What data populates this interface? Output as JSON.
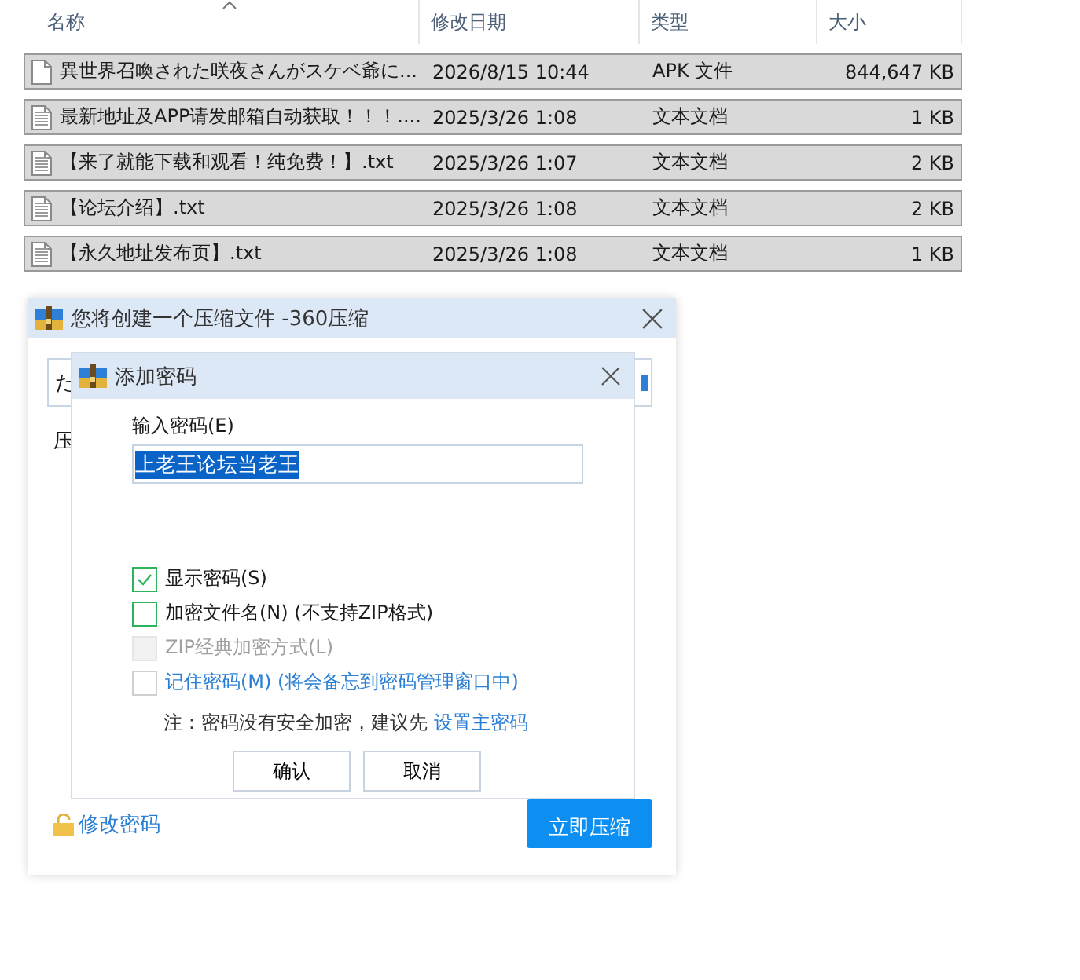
{
  "file_list": {
    "columns": [
      "名称",
      "修改日期",
      "类型",
      "大小"
    ],
    "rows": [
      {
        "kind": "blank",
        "name": "異世界召喚された咲夜さんがスケベ爺に...",
        "date": "2026/8/15 10:44",
        "type": "APK 文件",
        "size": "844,647 KB",
        "selected": true
      },
      {
        "kind": "text",
        "name": "最新地址及APP请发邮箱自动获取！！！....",
        "date": "2025/3/26 1:08",
        "type": "文本文档",
        "size": "1 KB",
        "selected": true
      },
      {
        "kind": "text",
        "name": "【来了就能下载和观看！纯免费！】.txt",
        "date": "2025/3/26 1:07",
        "type": "文本文档",
        "size": "2 KB",
        "selected": true
      },
      {
        "kind": "text",
        "name": "【论坛介绍】.txt",
        "date": "2025/3/26 1:08",
        "type": "文本文档",
        "size": "2 KB",
        "selected": true
      },
      {
        "kind": "text",
        "name": "【永久地址发布页】.txt",
        "date": "2025/3/26 1:08",
        "type": "文本文档",
        "size": "1 KB",
        "selected": true
      }
    ]
  },
  "compress_dialog": {
    "title": "您将创建一个压缩文件 -360压缩",
    "field_value": "た",
    "label": "压",
    "change_password": "修改密码",
    "primary_button": "立即压缩"
  },
  "password_dialog": {
    "title": "添加密码",
    "password_label": "输入密码(E)",
    "password_value": "上老王论坛当老王",
    "options": [
      {
        "kind": "plain",
        "label": "显示密码(S)",
        "checked": true,
        "disabled": false
      },
      {
        "kind": "plain",
        "label": "加密文件名(N) (不支持ZIP格式)",
        "checked": false,
        "disabled": false
      },
      {
        "kind": "plain",
        "label": "ZIP经典加密方式(L)",
        "checked": false,
        "disabled": true
      },
      {
        "kind": "link",
        "label": "记住密码(M) (将会备忘到密码管理窗口中)",
        "checked": false,
        "disabled": false
      }
    ],
    "note": "注：密码没有安全加密，建议先",
    "note_link": "设置主密码",
    "buttons": [
      "确认",
      "取消"
    ]
  }
}
